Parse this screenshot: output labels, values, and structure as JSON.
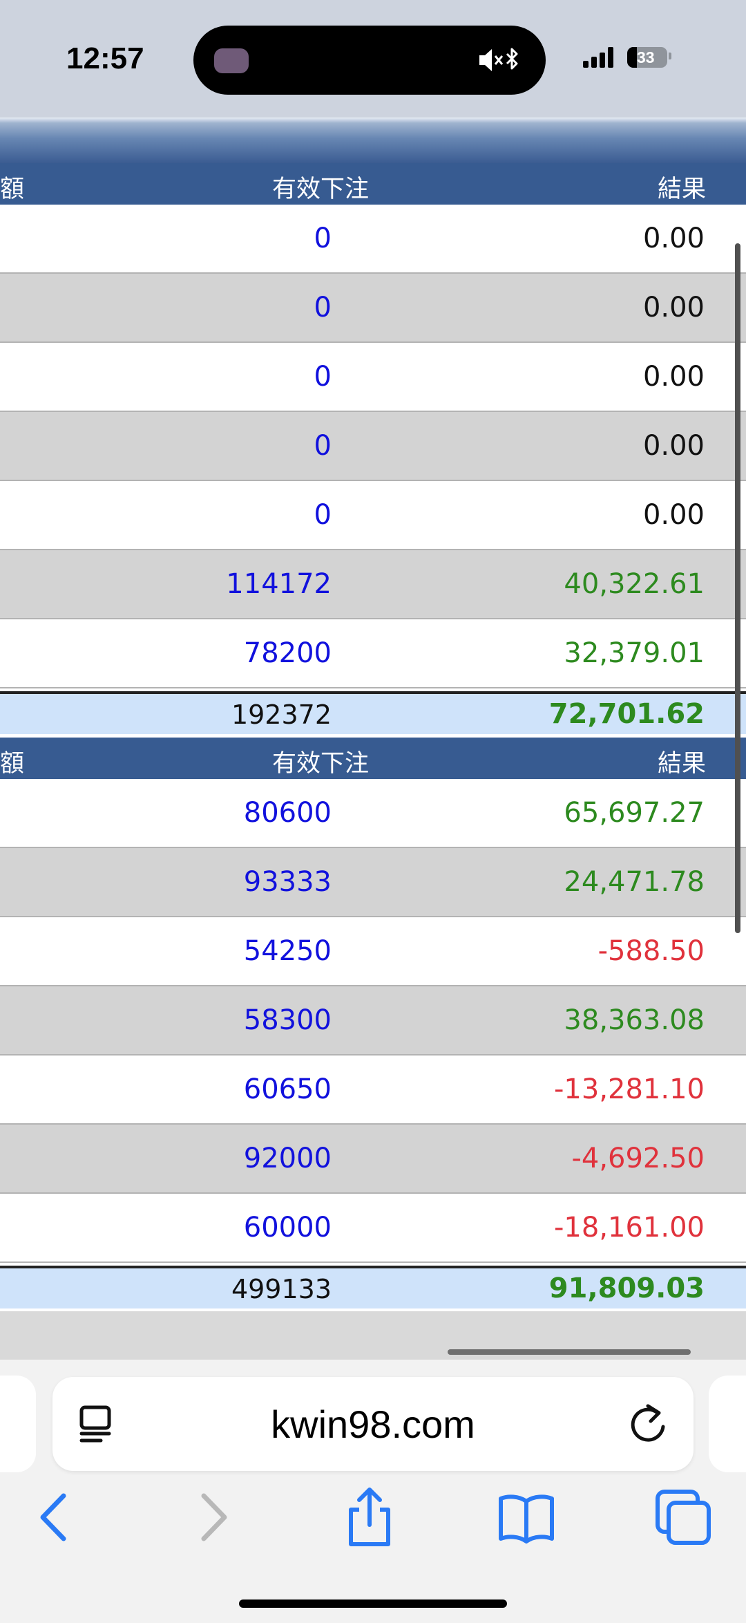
{
  "status_bar": {
    "time": "12:57",
    "battery": "33"
  },
  "table1": {
    "headers": {
      "col1": "額",
      "col2": "有效下注",
      "col3": "結果"
    },
    "rows": [
      {
        "bet": "0",
        "result": "0.00",
        "kind": "zero"
      },
      {
        "bet": "0",
        "result": "0.00",
        "kind": "zero"
      },
      {
        "bet": "0",
        "result": "0.00",
        "kind": "zero"
      },
      {
        "bet": "0",
        "result": "0.00",
        "kind": "zero"
      },
      {
        "bet": "0",
        "result": "0.00",
        "kind": "zero"
      },
      {
        "bet": "114172",
        "result": "40,322.61",
        "kind": "pos"
      },
      {
        "bet": "78200",
        "result": "32,379.01",
        "kind": "pos"
      }
    ],
    "total": {
      "bet": "192372",
      "result": "72,701.62"
    }
  },
  "table2": {
    "headers": {
      "col1": "額",
      "col2": "有效下注",
      "col3": "結果"
    },
    "rows": [
      {
        "bet": "80600",
        "result": "65,697.27",
        "kind": "pos"
      },
      {
        "bet": "93333",
        "result": "24,471.78",
        "kind": "pos"
      },
      {
        "bet": "54250",
        "result": "-588.50",
        "kind": "neg"
      },
      {
        "bet": "58300",
        "result": "38,363.08",
        "kind": "pos"
      },
      {
        "bet": "60650",
        "result": "-13,281.10",
        "kind": "neg"
      },
      {
        "bet": "92000",
        "result": "-4,692.50",
        "kind": "neg"
      },
      {
        "bet": "60000",
        "result": "-18,161.00",
        "kind": "neg"
      }
    ],
    "total": {
      "bet": "499133",
      "result": "91,809.03"
    }
  },
  "browser": {
    "url": "kwin98.com",
    "icons": {
      "reader": "reader-mode-icon",
      "reload": "reload-icon",
      "back": "back-chevron-icon",
      "forward": "forward-chevron-icon",
      "share": "share-icon",
      "bookmarks": "bookmarks-book-icon",
      "tabs": "tabs-icon"
    }
  },
  "colors": {
    "header_bg": "#375b91",
    "bet_text": "#1111dd",
    "positive": "#2d8a1f",
    "negative": "#e0323c",
    "total_bg": "#cfe3fa",
    "row_alt": "#d3d3d3",
    "safari_blue": "#2a7af5"
  }
}
